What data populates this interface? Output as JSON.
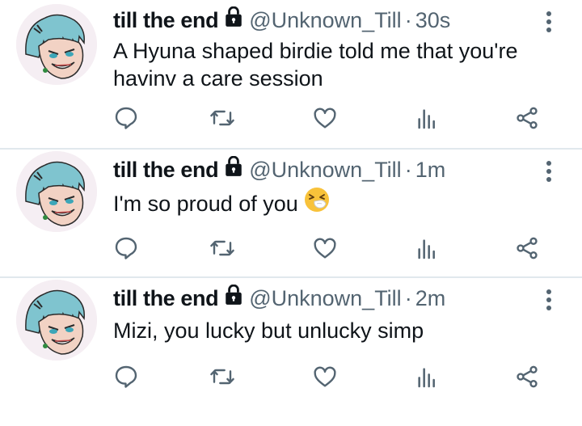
{
  "colors": {
    "text": "#0f1419",
    "secondary": "#536471",
    "divider": "#e1e8ed",
    "icon": "#536471"
  },
  "tweets": [
    {
      "display_name": "till the end",
      "handle": "@Unknown_Till",
      "separator": "·",
      "time": "30s",
      "text": "A Hyuna shaped birdie told me that you're havinv a care session",
      "emoji": ""
    },
    {
      "display_name": "till the end",
      "handle": "@Unknown_Till",
      "separator": "·",
      "time": "1m",
      "text": "I'm so proud of you",
      "emoji": "sneezing-face-emoji"
    },
    {
      "display_name": "till the end",
      "handle": "@Unknown_Till",
      "separator": "·",
      "time": "2m",
      "text": "Mizi, you lucky but unlucky simp",
      "emoji": ""
    }
  ],
  "icons": {
    "lock": "lock-icon",
    "more": "more-vertical-icon",
    "reply": "reply-icon",
    "retweet": "retweet-icon",
    "like": "heart-icon",
    "stats": "stats-icon",
    "share": "share-icon"
  }
}
